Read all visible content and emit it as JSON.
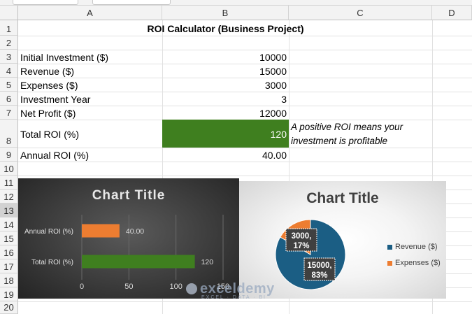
{
  "columns": [
    "A",
    "B",
    "C",
    "D"
  ],
  "rows": [
    "1",
    "2",
    "3",
    "4",
    "5",
    "6",
    "7",
    "8",
    "9",
    "10",
    "11",
    "12",
    "13",
    "14",
    "15",
    "16",
    "17",
    "18",
    "19",
    "20"
  ],
  "sheet": {
    "title": "ROI Calculator (Business Project)",
    "initial_investment_label": "Initial Investment ($)",
    "initial_investment_value": "10000",
    "revenue_label": "Revenue ($)",
    "revenue_value": "15000",
    "expenses_label": "Expenses ($)",
    "expenses_value": "3000",
    "investment_year_label": "Investment Year",
    "investment_year_value": "3",
    "net_profit_label": "Net Profit ($)",
    "net_profit_value": "12000",
    "total_roi_label": "Total ROI (%)",
    "total_roi_value": "120",
    "roi_note": "A positive ROI means your investment is profitable",
    "annual_roi_label": "Annual ROI (%)",
    "annual_roi_value": "40.00"
  },
  "colors": {
    "green_fill": "#3f7f1f",
    "orange": "#ed7d31",
    "blue": "#1b5e84"
  },
  "watermark": {
    "name": "exceldemy",
    "tagline": "EXCEL · DATA · BI"
  },
  "chart_data": [
    {
      "type": "bar",
      "orientation": "horizontal",
      "title": "Chart Title",
      "categories": [
        "Annual ROI (%)",
        "Total ROI (%)"
      ],
      "values": [
        40,
        120
      ],
      "data_labels": [
        "40.00",
        "120"
      ],
      "bar_colors": [
        "#ed7d31",
        "#3f7f1f"
      ],
      "xlim": [
        0,
        150
      ],
      "xticks": [
        0,
        50,
        100,
        150
      ],
      "xtick_labels": [
        "0",
        "50",
        "100",
        "150"
      ],
      "grid": true,
      "legend": "none"
    },
    {
      "type": "pie",
      "title": "Chart Title",
      "categories": [
        "Revenue ($)",
        "Expenses ($)"
      ],
      "values": [
        15000,
        3000
      ],
      "percents": [
        83,
        17
      ],
      "data_labels": [
        "15000, 83%",
        "3000, 17%"
      ],
      "colors": [
        "#1b5e84",
        "#ed7d31"
      ],
      "legend": "right"
    }
  ]
}
